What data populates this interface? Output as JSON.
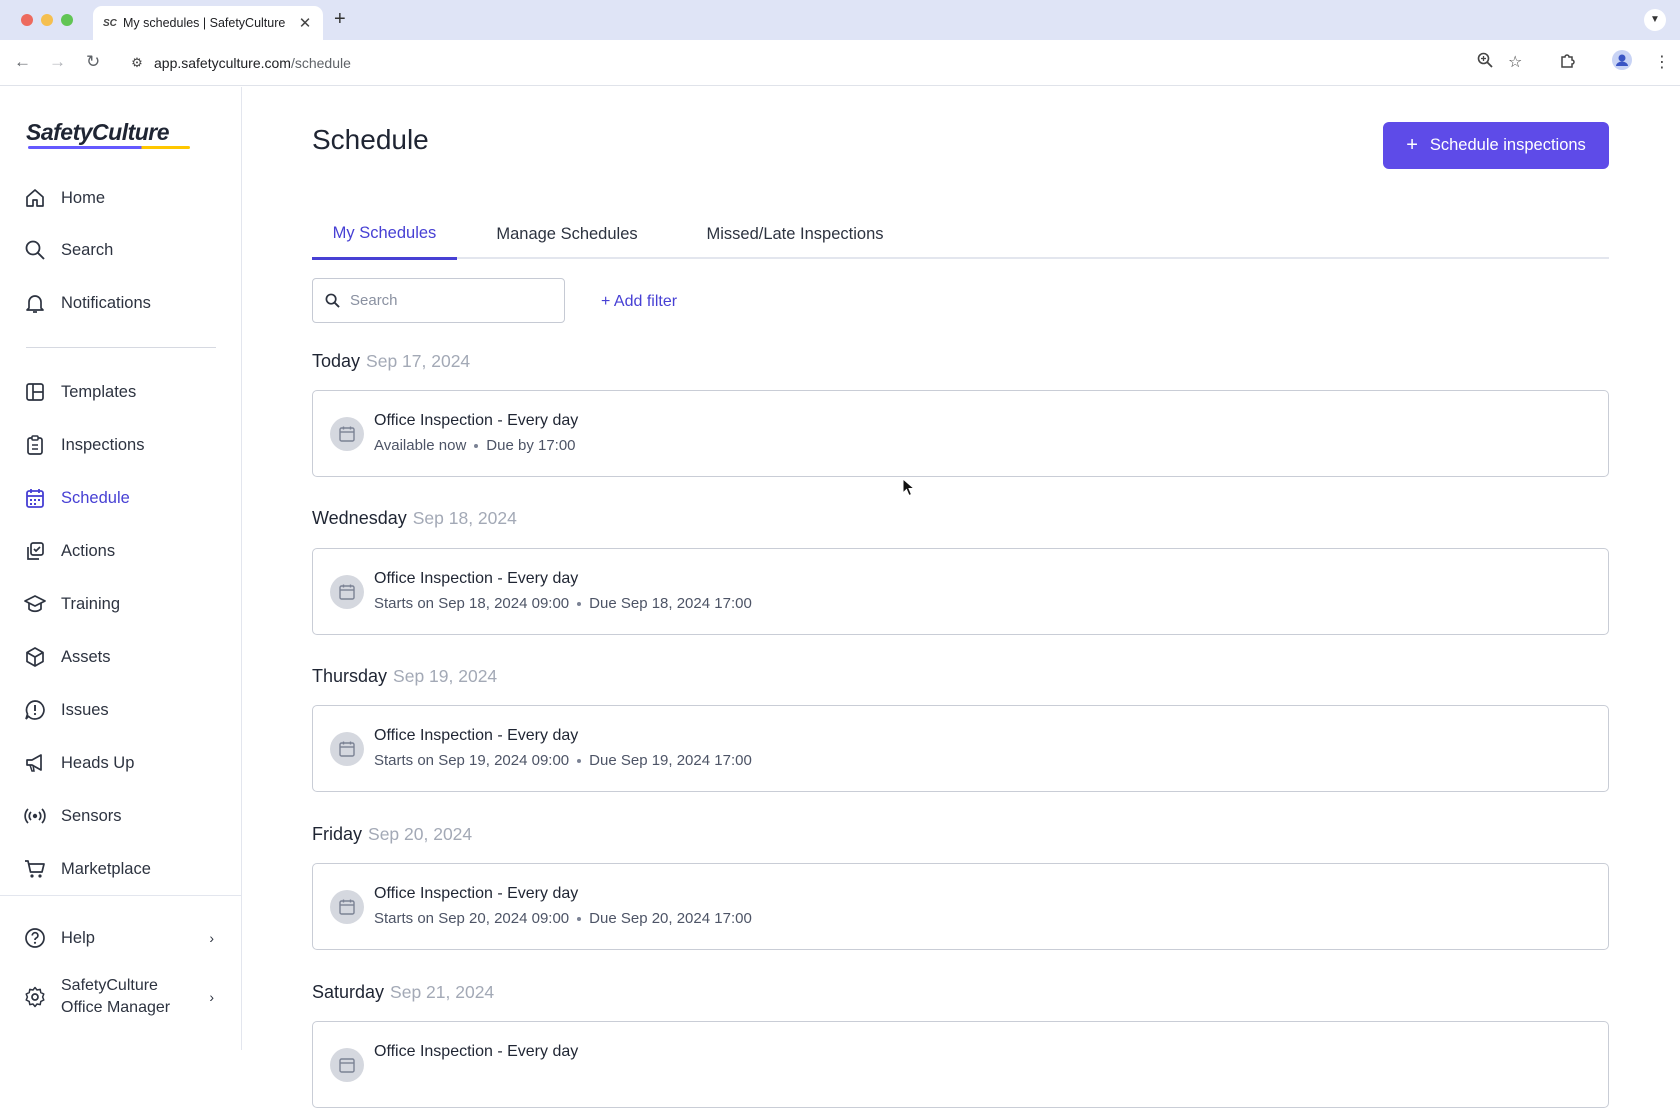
{
  "browser": {
    "tab_title": "My schedules | SafetyCulture",
    "tab_favicon": "SC",
    "url_host": "app.safetyculture.com",
    "url_path": "/schedule"
  },
  "sidebar": {
    "logo": "SafetyCulture",
    "items": [
      {
        "label": "Home",
        "icon": "home-icon"
      },
      {
        "label": "Search",
        "icon": "search-icon"
      },
      {
        "label": "Notifications",
        "icon": "bell-icon"
      },
      {
        "label": "Templates",
        "icon": "templates-icon"
      },
      {
        "label": "Inspections",
        "icon": "clipboard-icon"
      },
      {
        "label": "Schedule",
        "icon": "calendar-icon",
        "active": true
      },
      {
        "label": "Actions",
        "icon": "actions-icon"
      },
      {
        "label": "Training",
        "icon": "graduation-cap-icon"
      },
      {
        "label": "Assets",
        "icon": "cube-icon"
      },
      {
        "label": "Issues",
        "icon": "alert-icon"
      },
      {
        "label": "Heads Up",
        "icon": "megaphone-icon"
      },
      {
        "label": "Sensors",
        "icon": "sensor-icon"
      },
      {
        "label": "Marketplace",
        "icon": "cart-icon"
      }
    ],
    "help_label": "Help",
    "profile_line1": "SafetyCulture",
    "profile_line2": "Office Manager"
  },
  "main": {
    "title": "Schedule",
    "primary_button": "Schedule inspections",
    "tabs": [
      {
        "label": "My Schedules",
        "active": true
      },
      {
        "label": "Manage Schedules"
      },
      {
        "label": "Missed/Late Inspections"
      }
    ],
    "search_placeholder": "Search",
    "add_filter": "+ Add filter",
    "days": [
      {
        "day": "Today",
        "date": "Sep 17, 2024",
        "card": {
          "title": "Office Inspection - Every day",
          "sub1": "Available now",
          "sub2": "Due by 17:00"
        }
      },
      {
        "day": "Wednesday",
        "date": "Sep 18, 2024",
        "card": {
          "title": "Office Inspection - Every day",
          "sub1": "Starts on Sep 18, 2024 09:00",
          "sub2": "Due Sep 18, 2024 17:00"
        }
      },
      {
        "day": "Thursday",
        "date": "Sep 19, 2024",
        "card": {
          "title": "Office Inspection - Every day",
          "sub1": "Starts on Sep 19, 2024 09:00",
          "sub2": "Due Sep 19, 2024 17:00"
        }
      },
      {
        "day": "Friday",
        "date": "Sep 20, 2024",
        "card": {
          "title": "Office Inspection - Every day",
          "sub1": "Starts on Sep 20, 2024 09:00",
          "sub2": "Due Sep 20, 2024 17:00"
        }
      },
      {
        "day": "Saturday",
        "date": "Sep 21, 2024",
        "card": {
          "title": "Office Inspection - Every day",
          "sub1": "",
          "sub2": ""
        }
      }
    ]
  },
  "colors": {
    "accent": "#4740d4",
    "button": "#5e4be8"
  }
}
